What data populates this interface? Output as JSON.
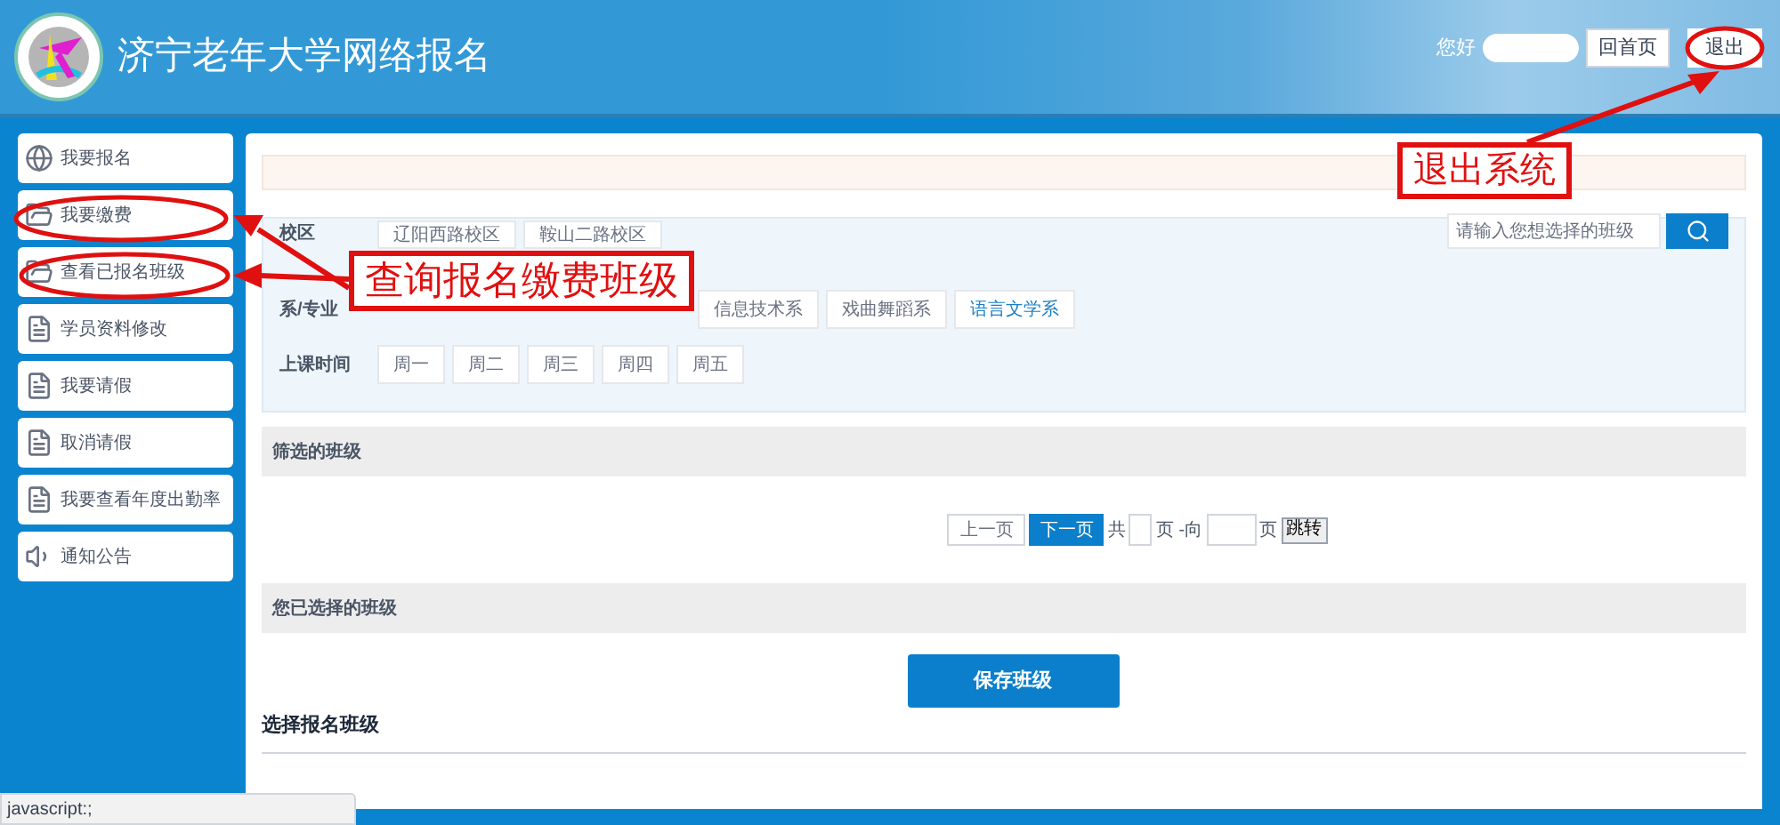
{
  "header": {
    "title": "济宁老年大学网络报名",
    "greeting": "您好",
    "home_button": "回首页",
    "logout_button": "退出"
  },
  "sidebar": {
    "items": [
      {
        "label": "我要报名",
        "kind": "globe"
      },
      {
        "label": "我要缴费",
        "kind": "folder"
      },
      {
        "label": "查看已报名班级",
        "kind": "folder"
      },
      {
        "label": "学员资料修改",
        "kind": "document"
      },
      {
        "label": "我要请假",
        "kind": "document"
      },
      {
        "label": "取消请假",
        "kind": "document"
      },
      {
        "label": "我要查看年度出勤率",
        "kind": "document"
      },
      {
        "label": "通知公告",
        "kind": "speaker"
      }
    ]
  },
  "filter": {
    "search": {
      "placeholder": "请输入您想选择的班级"
    },
    "rows": [
      {
        "label": "校区",
        "options": [
          {
            "label": "辽阳西路校区",
            "selected": false
          },
          {
            "label": "鞍山二路校区",
            "selected": false
          }
        ]
      },
      {
        "label": "系/专业",
        "options": [
          {
            "label": "信息技术系",
            "selected": false
          },
          {
            "label": "戏曲舞蹈系",
            "selected": false
          },
          {
            "label": "语言文学系",
            "selected": true
          }
        ]
      },
      {
        "label": "上课时间",
        "options": [
          {
            "label": "周一",
            "selected": false
          },
          {
            "label": "周二",
            "selected": false
          },
          {
            "label": "周三",
            "selected": false
          },
          {
            "label": "周四",
            "selected": false
          },
          {
            "label": "周五",
            "selected": false
          }
        ]
      }
    ]
  },
  "filtered_section": {
    "title": "筛选的班级"
  },
  "pagination": {
    "prev": "上一页",
    "next": "下一页",
    "total_prefix": "共",
    "total_suffix": "页 -向",
    "goto_suffix": "页",
    "goto_button": "跳转"
  },
  "selected_section": {
    "title": "您已选择的班级"
  },
  "save_button": "保存班级",
  "enroll_heading": "选择报名班级",
  "status_bar": "javascript:;",
  "annotations": [
    {
      "text": "退出系统"
    },
    {
      "text": "查询报名缴费班级"
    }
  ]
}
